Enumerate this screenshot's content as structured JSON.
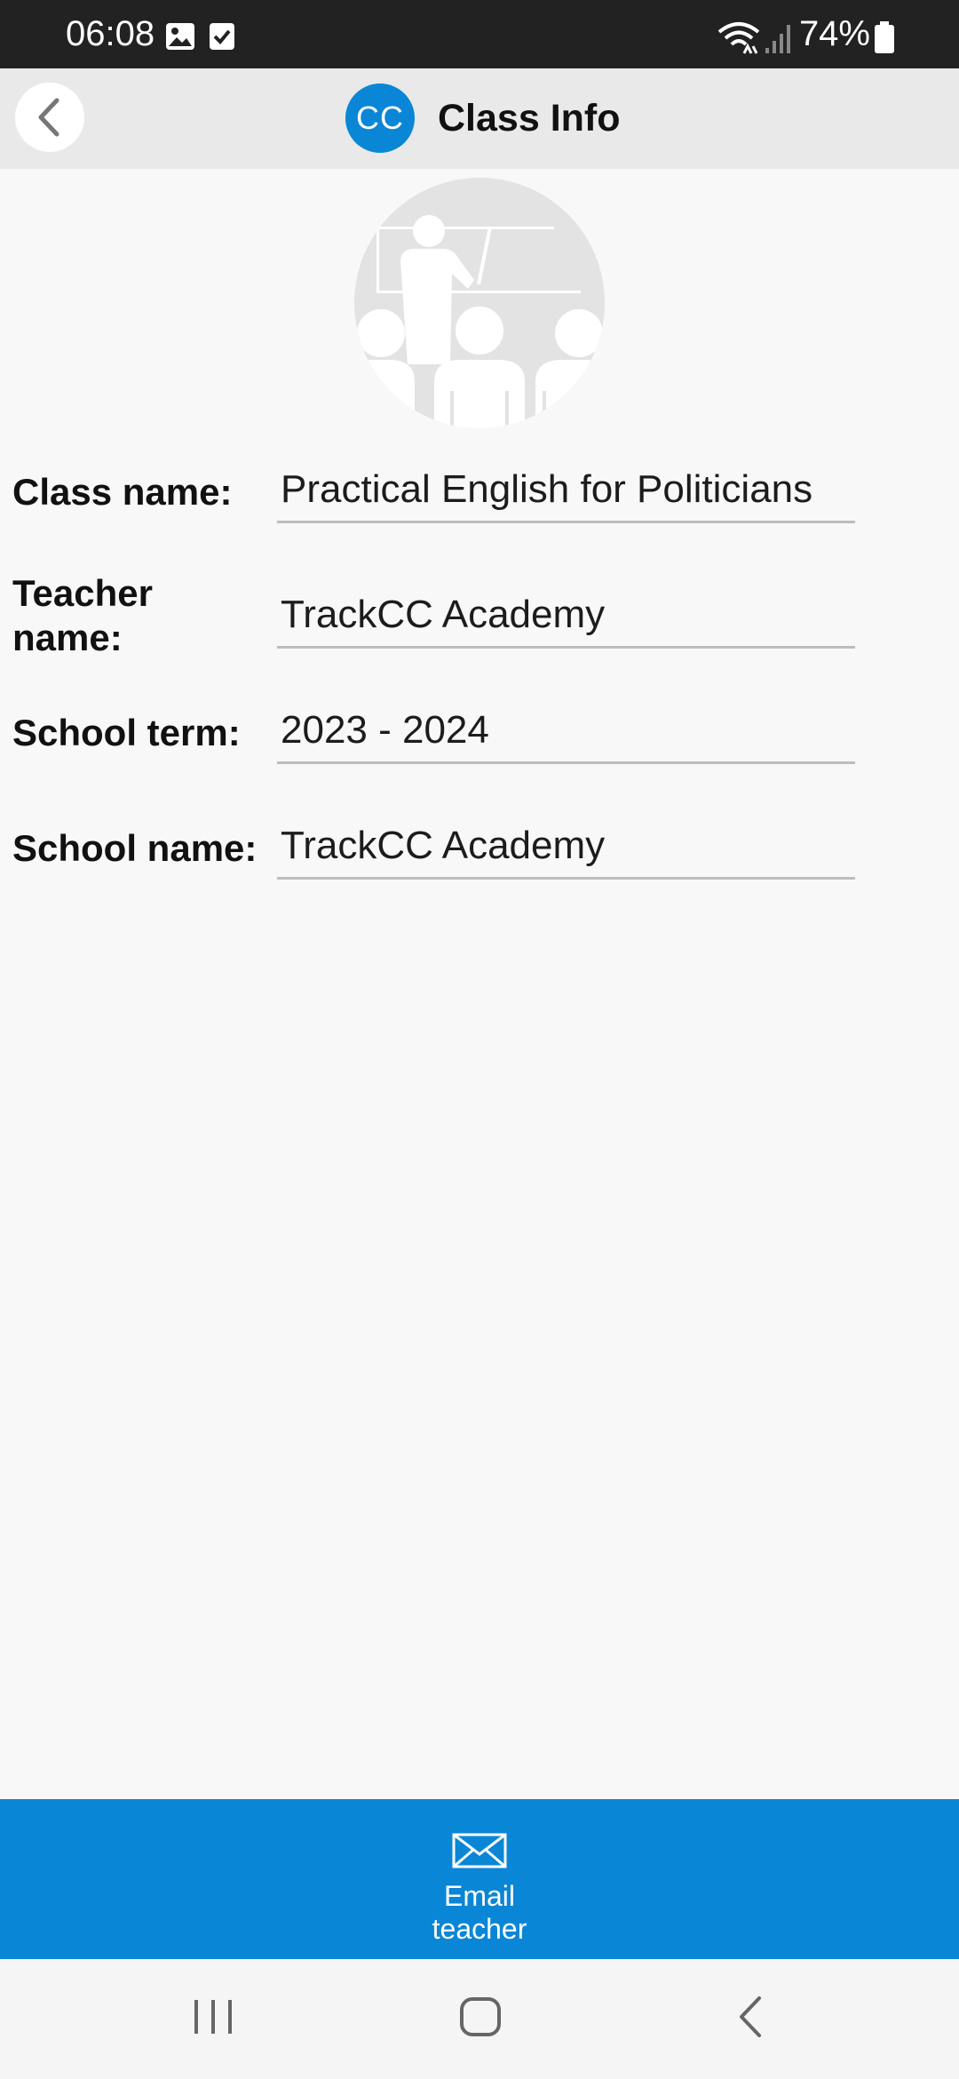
{
  "status_bar": {
    "time": "06:08",
    "battery_percent": "74%"
  },
  "header": {
    "logo_text": "CC",
    "title": "Class Info"
  },
  "fields": {
    "class_name": {
      "label": "Class name:",
      "value": "Practical English for Politicians"
    },
    "teacher_name": {
      "label_line1": "Teacher",
      "label_line2": "name:",
      "value": "TrackCC Academy"
    },
    "school_term": {
      "label": "School term:",
      "value": "2023 - 2024"
    },
    "school_name": {
      "label": "School name:",
      "value": "TrackCC Academy"
    }
  },
  "email_bar": {
    "label": "Email\nteacher"
  },
  "colors": {
    "accent": "#0a86d6",
    "header_bg": "#e9e9e9",
    "status_bg": "#222222"
  }
}
